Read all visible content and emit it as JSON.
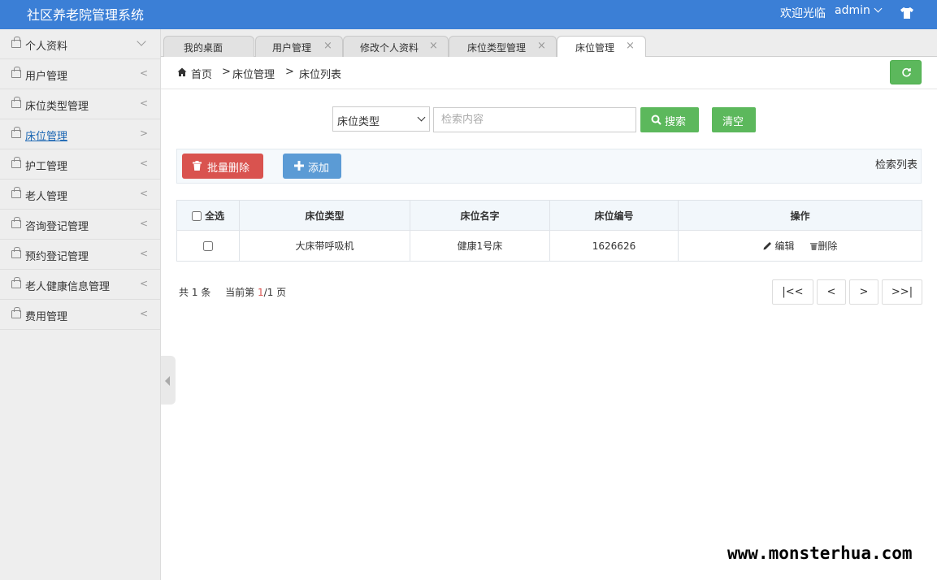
{
  "header": {
    "title": "社区养老院管理系统",
    "welcome": "欢迎光临",
    "user": "admin"
  },
  "sidebar": {
    "items": [
      {
        "label": "个人资料",
        "icon": "bag-icon",
        "indicator": "chevron-down"
      },
      {
        "label": "用户管理",
        "icon": "bag-icon",
        "indicator": "<"
      },
      {
        "label": "床位类型管理",
        "icon": "bag-icon",
        "indicator": "<"
      },
      {
        "label": "床位管理",
        "icon": "bag-icon",
        "indicator": ">",
        "active": true
      },
      {
        "label": "护工管理",
        "icon": "bag-icon",
        "indicator": "<"
      },
      {
        "label": "老人管理",
        "icon": "bag-icon",
        "indicator": "<"
      },
      {
        "label": "咨询登记管理",
        "icon": "bag-icon",
        "indicator": "<"
      },
      {
        "label": "预约登记管理",
        "icon": "bag-icon",
        "indicator": "<"
      },
      {
        "label": "老人健康信息管理",
        "icon": "bag-icon",
        "indicator": "<"
      },
      {
        "label": "费用管理",
        "icon": "bag-icon",
        "indicator": "<"
      }
    ]
  },
  "tabs": [
    {
      "label": "我的桌面",
      "closable": false
    },
    {
      "label": "用户管理",
      "closable": true,
      "close": "×"
    },
    {
      "label": "修改个人资料",
      "closable": true,
      "close": "×"
    },
    {
      "label": "床位类型管理",
      "closable": true,
      "close": "×"
    },
    {
      "label": "床位管理",
      "closable": true,
      "close": "×",
      "active": true
    }
  ],
  "breadcrumb": {
    "home": "首页",
    "sep1": ">",
    "level1": "床位管理",
    "sep2": ">",
    "level2": "床位列表"
  },
  "search": {
    "select_value": "床位类型",
    "placeholder": "检索内容",
    "search_label": "搜索",
    "clear_label": "清空"
  },
  "toolbar": {
    "batch_delete_label": "批量删除",
    "add_label": "添加",
    "title": "检索列表"
  },
  "table": {
    "select_all": "全选",
    "columns": [
      "床位类型",
      "床位名字",
      "床位编号",
      "操作"
    ],
    "rows": [
      {
        "type": "大床带呼吸机",
        "name": "健康1号床",
        "code": "1626626",
        "edit": "编辑",
        "delete": "删除"
      }
    ]
  },
  "pager": {
    "total_prefix": "共",
    "total": "1",
    "total_suffix": "条",
    "current_prefix": "当前第",
    "current": "1",
    "slash": "/",
    "pages": "1",
    "pages_suffix": "页",
    "first": "|<<",
    "prev": "<",
    "next": ">",
    "last": ">>|"
  },
  "watermark": "www.monsterhua.com",
  "colors": {
    "header": "#3b7fd6",
    "green": "#5cb85c",
    "red": "#d9534f",
    "blue": "#5b9bd5"
  }
}
